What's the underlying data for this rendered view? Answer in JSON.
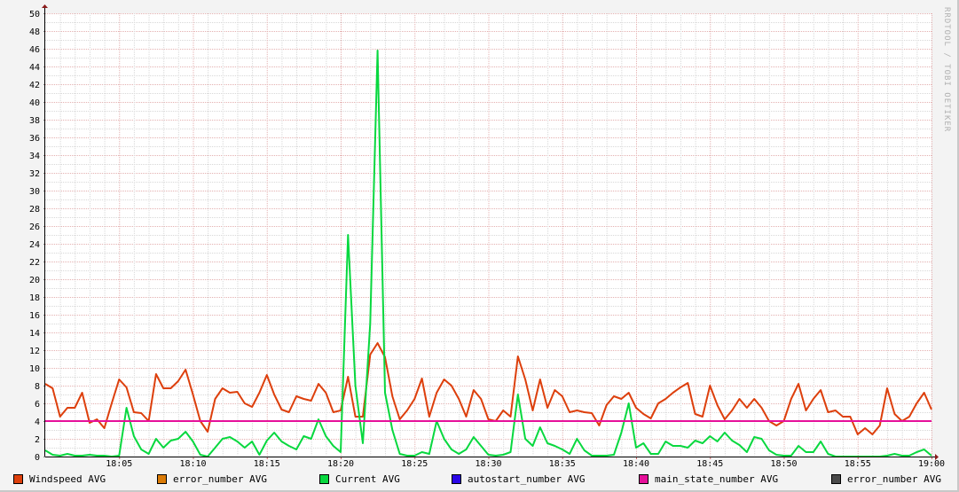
{
  "chart_data": {
    "type": "line",
    "title": "",
    "xlabel": "",
    "ylabel": "",
    "watermark": "RRDTOOL / TOBI OETIKER",
    "ylim": [
      0,
      50
    ],
    "y_ticks": [
      "0",
      "2",
      "4",
      "6",
      "8",
      "10",
      "12",
      "14",
      "16",
      "18",
      "20",
      "22",
      "24",
      "26",
      "28",
      "30",
      "32",
      "34",
      "36",
      "38",
      "40",
      "42",
      "44",
      "46",
      "48",
      "50"
    ],
    "x_range_minutes": [
      0,
      60
    ],
    "x_start": "18:00",
    "x_ticks": [
      {
        "label": "18:05",
        "min": 5
      },
      {
        "label": "18:10",
        "min": 10
      },
      {
        "label": "18:15",
        "min": 15
      },
      {
        "label": "18:20",
        "min": 20
      },
      {
        "label": "18:25",
        "min": 25
      },
      {
        "label": "18:30",
        "min": 30
      },
      {
        "label": "18:35",
        "min": 35
      },
      {
        "label": "18:40",
        "min": 40
      },
      {
        "label": "18:45",
        "min": 45
      },
      {
        "label": "18:50",
        "min": 50
      },
      {
        "label": "18:55",
        "min": 55
      },
      {
        "label": "19:00",
        "min": 60
      }
    ],
    "grid": true,
    "legend_position": "bottom",
    "sample_interval_minutes": 0.5,
    "series": [
      {
        "name": "Windspeed AVG",
        "color": "#dd3f0c",
        "values": [
          8.2,
          7.7,
          4.5,
          5.5,
          5.5,
          7.2,
          3.8,
          4.2,
          3.2,
          6,
          8.7,
          7.8,
          5,
          4.9,
          4,
          9.3,
          7.7,
          7.7,
          8.5,
          9.8,
          7,
          4,
          2.8,
          6.5,
          7.7,
          7.2,
          7.3,
          6,
          5.6,
          7.2,
          9.2,
          7,
          5.3,
          5,
          6.8,
          6.5,
          6.3,
          8.2,
          7.2,
          5,
          5.2,
          9,
          4.5,
          4.5,
          11.5,
          12.8,
          11.2,
          6.8,
          4.2,
          5.2,
          6.5,
          8.8,
          4.5,
          7.2,
          8.7,
          8,
          6.5,
          4.5,
          7.5,
          6.5,
          4.2,
          4,
          5.2,
          4.5,
          11.3,
          8.7,
          5.2,
          8.7,
          5.5,
          7.5,
          6.8,
          5,
          5.2,
          5,
          4.9,
          3.5,
          5.8,
          6.8,
          6.5,
          7.2,
          5.5,
          4.8,
          4.3,
          6,
          6.5,
          7.2,
          7.8,
          8.3,
          4.8,
          4.5,
          8,
          5.8,
          4.2,
          5.2,
          6.5,
          5.5,
          6.5,
          5.5,
          4,
          3.5,
          4,
          6.5,
          8.2,
          5.2,
          6.5,
          7.5,
          5,
          5.2,
          4.5,
          4.5,
          2.5,
          3.2,
          2.5,
          3.5,
          7.7,
          4.8,
          4,
          4.5,
          6,
          7.2,
          5.3
        ]
      },
      {
        "name": "error_number AVG",
        "color": "#db7b06",
        "values": []
      },
      {
        "name": "Current AVG",
        "color": "#08d83f",
        "values": [
          0.7,
          0.2,
          0.1,
          0.3,
          0.1,
          0.1,
          0.2,
          0.1,
          0.1,
          0,
          0.1,
          5.5,
          2.3,
          0.8,
          0.3,
          2,
          1,
          1.8,
          2,
          2.8,
          1.7,
          0.2,
          0,
          1,
          2,
          2.2,
          1.7,
          1,
          1.7,
          0.2,
          1.8,
          2.7,
          1.7,
          1.2,
          0.8,
          2.3,
          2,
          4.2,
          2.3,
          1.2,
          0.5,
          25,
          8,
          1.5,
          15,
          45.8,
          7.2,
          3,
          0.3,
          0.1,
          0.1,
          0.5,
          0.3,
          4,
          2,
          0.8,
          0.3,
          0.8,
          2.2,
          1.2,
          0.2,
          0.1,
          0.2,
          0.5,
          7,
          2,
          1.2,
          3.3,
          1.5,
          1.2,
          0.8,
          0.3,
          2,
          0.7,
          0.1,
          0.1,
          0.1,
          0.2,
          2.7,
          6,
          1,
          1.5,
          0.3,
          0.3,
          1.7,
          1.2,
          1.2,
          1,
          1.8,
          1.5,
          2.3,
          1.7,
          2.7,
          1.8,
          1.3,
          0.5,
          2.2,
          2,
          0.7,
          0.2,
          0.1,
          0.1,
          1.2,
          0.5,
          0.5,
          1.7,
          0.3,
          0,
          0,
          0,
          0,
          0,
          0,
          0,
          0.1,
          0.3,
          0.1,
          0.1,
          0.5,
          0.8,
          0.1
        ]
      },
      {
        "name": "autostart_number AVG",
        "color": "#2a06e6",
        "values": []
      },
      {
        "name": "main_state_number AVG",
        "color": "#e6109a",
        "constant": 4
      },
      {
        "name": "error_number AVG",
        "color": "#4a4a4a",
        "values": []
      }
    ]
  }
}
